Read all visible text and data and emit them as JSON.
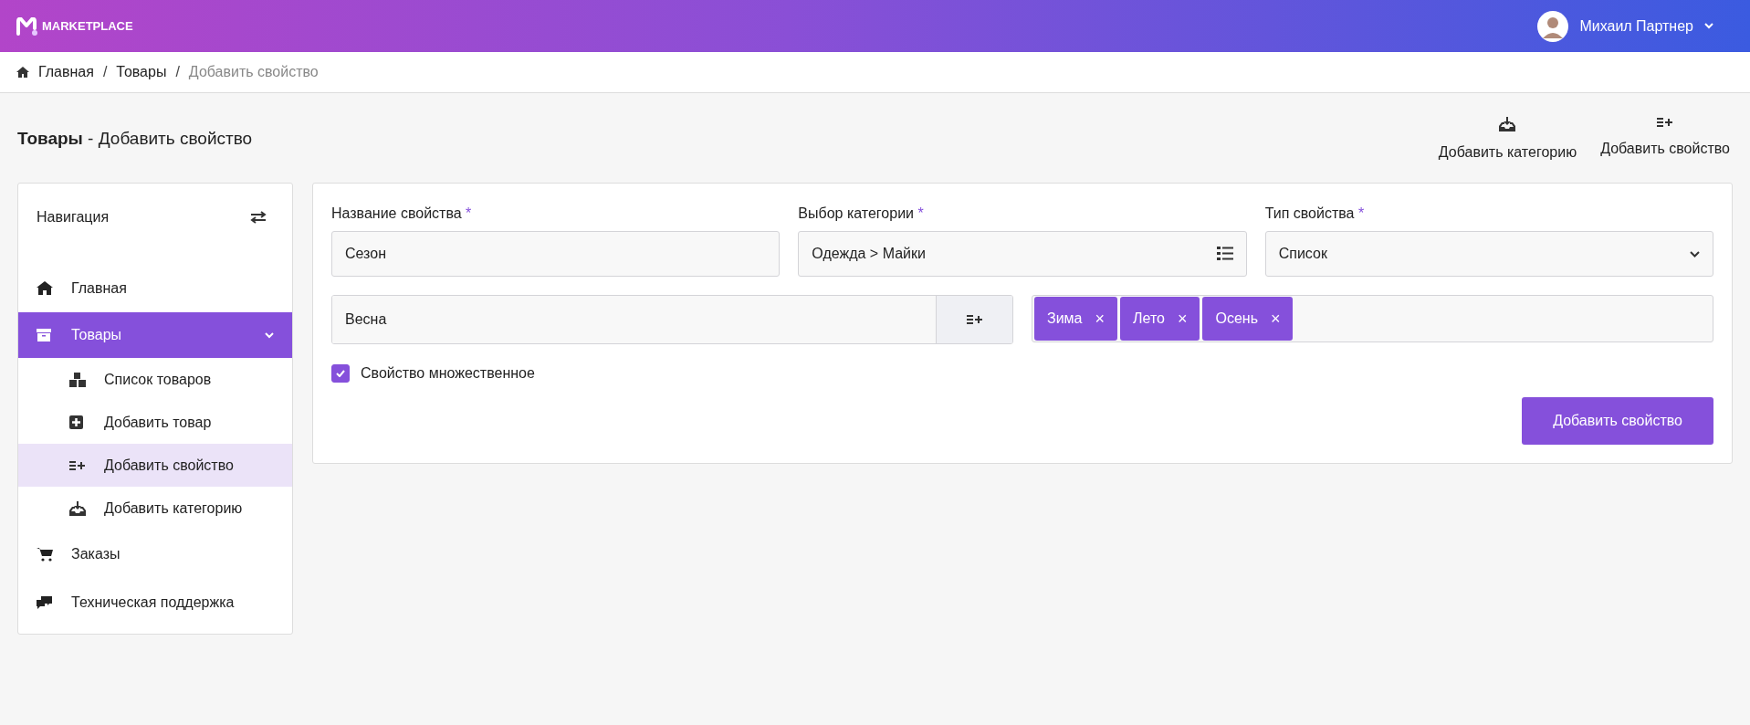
{
  "header": {
    "logo_text": "MARKETPLACE",
    "user_name": "Михаил Партнер"
  },
  "breadcrumb": [
    {
      "label": "Главная",
      "current": false
    },
    {
      "label": "Товары",
      "current": false
    },
    {
      "label": "Добавить свойство",
      "current": true
    }
  ],
  "breadcrumb_separator": "/",
  "page_title": {
    "section": "Товары",
    "separator": "-",
    "action": "Добавить свойство"
  },
  "page_actions": [
    {
      "label": "Добавить категорию",
      "kind": "category"
    },
    {
      "label": "Добавить свойство",
      "kind": "property"
    }
  ],
  "sidebar": {
    "title": "Навигация",
    "items": [
      {
        "label": "Главная",
        "kind": "home",
        "selected": false
      },
      {
        "label": "Товары",
        "kind": "box",
        "selected": true,
        "expanded": true,
        "children": [
          {
            "label": "Список товаров",
            "kind": "boxes",
            "selected": false
          },
          {
            "label": "Добавить товар",
            "kind": "plus",
            "selected": false
          },
          {
            "label": "Добавить свойство",
            "kind": "property",
            "selected": true
          },
          {
            "label": "Добавить категорию",
            "kind": "category",
            "selected": false
          }
        ]
      },
      {
        "label": "Заказы",
        "kind": "cart",
        "selected": false
      },
      {
        "label": "Техническая поддержка",
        "kind": "chat",
        "selected": false
      }
    ]
  },
  "form": {
    "fields": [
      {
        "label": "Название свойства",
        "required_mark": "*",
        "value": "Сезон",
        "kind": "text"
      },
      {
        "label": "Выбор категории",
        "required_mark": "*",
        "value": "Одежда > Майки",
        "kind": "category"
      },
      {
        "label": "Тип свойства",
        "required_mark": "*",
        "value": "Список",
        "kind": "select"
      }
    ],
    "value_input": {
      "value": "Весна"
    },
    "tags": [
      {
        "label": "Зима",
        "remove": "×"
      },
      {
        "label": "Лето",
        "remove": "×"
      },
      {
        "label": "Осень",
        "remove": "×"
      }
    ],
    "multiple": {
      "label": "Свойство множественное",
      "checked": true
    },
    "submit": "Добавить свойство"
  }
}
